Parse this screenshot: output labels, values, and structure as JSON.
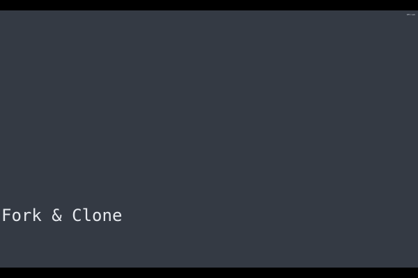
{
  "slide": {
    "title": "Fork & Clone",
    "corner_label": "RFC Lab"
  },
  "colors": {
    "background": "#343a44",
    "letterbox": "#000000",
    "title_text": "#e6e9ee"
  }
}
